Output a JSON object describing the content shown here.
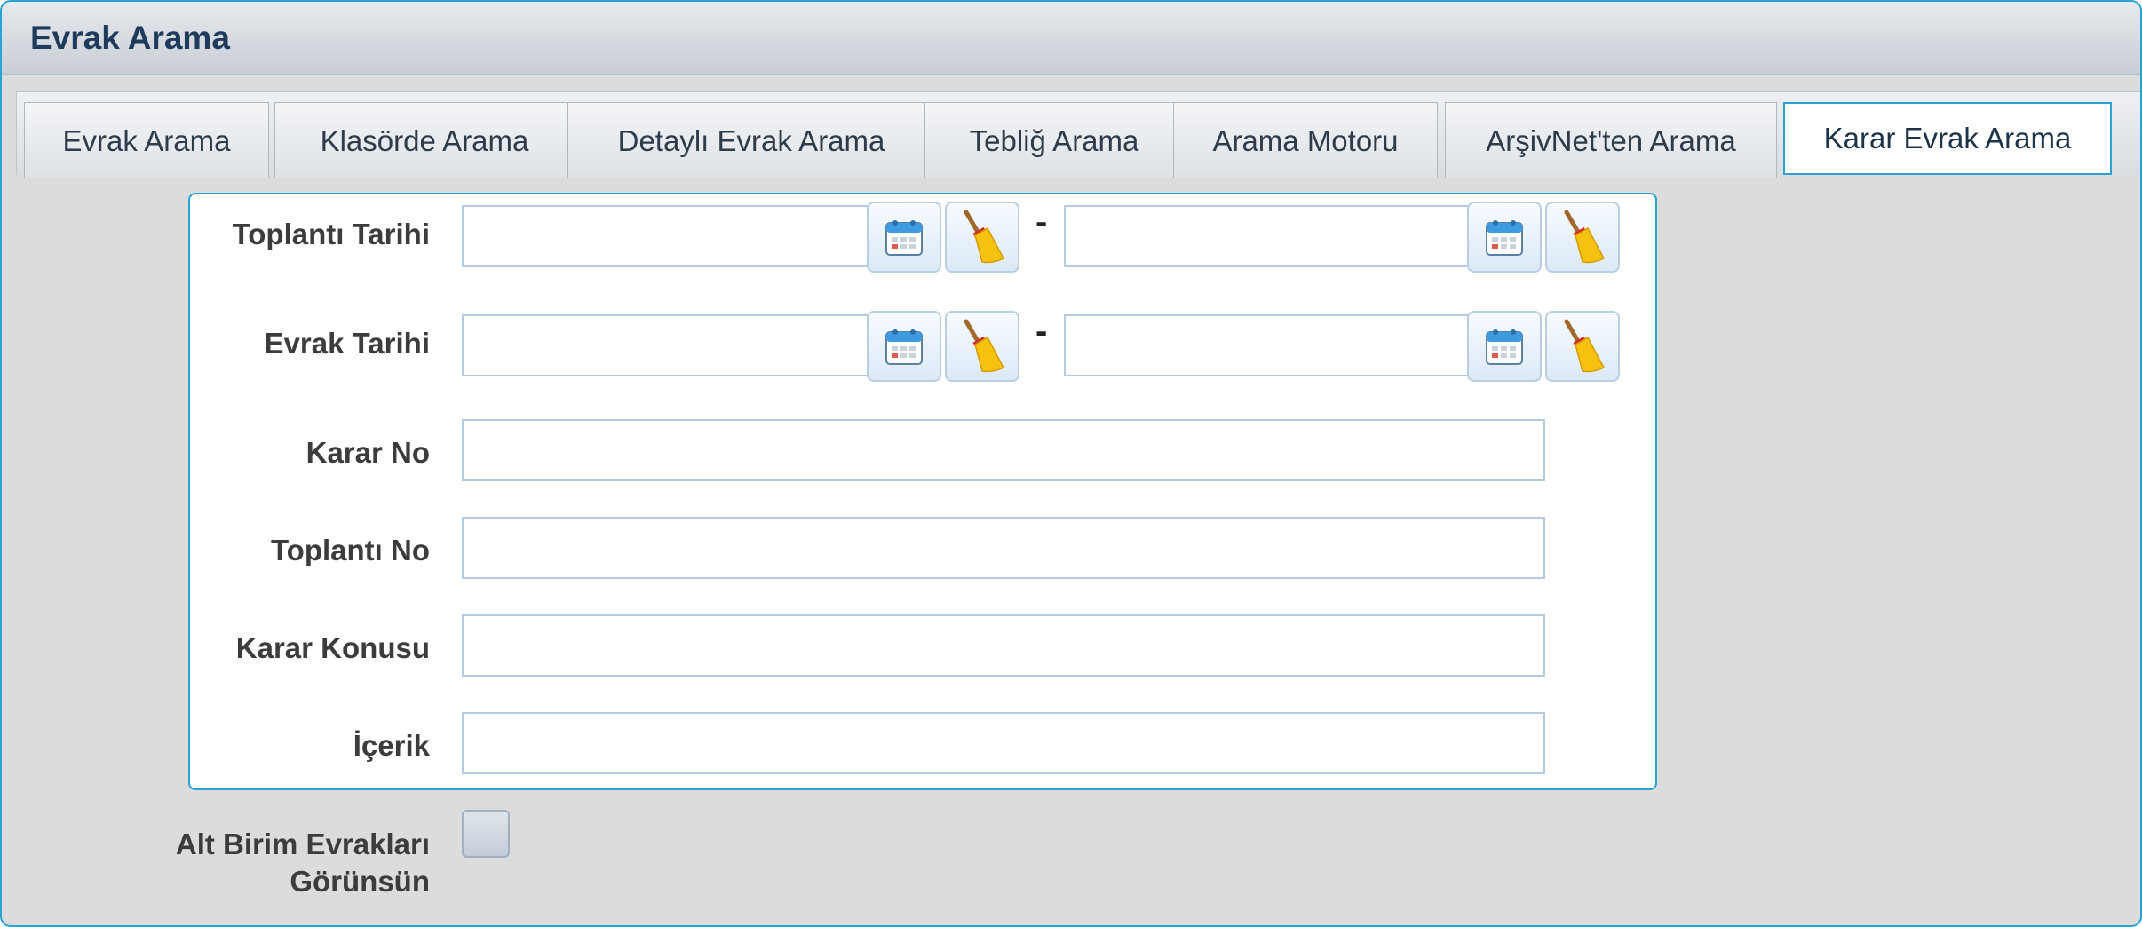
{
  "header": {
    "title": "Evrak Arama"
  },
  "tabs": [
    {
      "label": "Evrak Arama"
    },
    {
      "label": "Klasörde Arama"
    },
    {
      "label": "Detaylı Evrak Arama"
    },
    {
      "label": "Tebliğ Arama"
    },
    {
      "label": "Arama Motoru"
    },
    {
      "label": "ArşivNet'ten Arama"
    },
    {
      "label": "Karar Evrak Arama",
      "active": true
    }
  ],
  "form": {
    "toplanti_tarihi": {
      "label": "Toplantı Tarihi",
      "from_value": "",
      "to_value": "",
      "separator": "-"
    },
    "evrak_tarihi": {
      "label": "Evrak Tarihi",
      "from_value": "",
      "to_value": "",
      "separator": "-"
    },
    "karar_no": {
      "label": "Karar No",
      "value": ""
    },
    "toplanti_no": {
      "label": "Toplantı No",
      "value": ""
    },
    "karar_konusu": {
      "label": "Karar Konusu",
      "value": ""
    },
    "icerik": {
      "label": "İçerik",
      "value": ""
    }
  },
  "alt_birim": {
    "label_line1": "Alt Birim Evrakları",
    "label_line2": "Görünsün",
    "checked": false
  },
  "icons": {
    "calendar": "calendar-icon",
    "clear": "broom-icon"
  },
  "colors": {
    "accent": "#2aa3d4",
    "label": "#3c3c3c",
    "title": "#1f3b5c"
  }
}
